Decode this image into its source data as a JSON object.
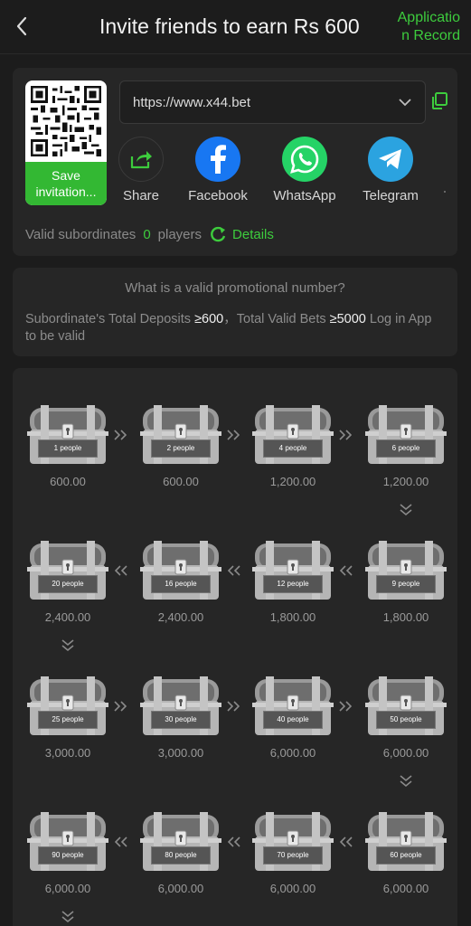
{
  "header": {
    "title": "Invite friends to earn Rs 600",
    "application_record": "Application Record"
  },
  "invite": {
    "save_label": "Save invitation...",
    "url": "https://www.x44.bet",
    "share": [
      {
        "label": "Share",
        "icon": "share-icon",
        "color": "#262626"
      },
      {
        "label": "Facebook",
        "icon": "facebook-icon",
        "color": "#1877f2"
      },
      {
        "label": "WhatsApp",
        "icon": "whatsapp-icon",
        "color": "#25d366"
      },
      {
        "label": "Telegram",
        "icon": "telegram-icon",
        "color": "#2ba3e0"
      }
    ],
    "valid_subordinates_label": "Valid subordinates",
    "valid_count": "0",
    "players_label": "players",
    "details_label": "Details"
  },
  "promo": {
    "question": "What is a valid promotional number?",
    "desc_prefix": "Subordinate's Total Deposits ",
    "deposit_value": "≥600",
    "desc_mid": "，Total Valid Bets ",
    "bet_value": "≥5000",
    "desc_suffix": " Log in App to be valid"
  },
  "rewards": [
    {
      "people": "1 people",
      "amount": "600.00"
    },
    {
      "people": "2 people",
      "amount": "600.00"
    },
    {
      "people": "4 people",
      "amount": "1,200.00"
    },
    {
      "people": "6 people",
      "amount": "1,200.00"
    },
    {
      "people": "9 people",
      "amount": "1,800.00"
    },
    {
      "people": "12 people",
      "amount": "1,800.00"
    },
    {
      "people": "16 people",
      "amount": "2,400.00"
    },
    {
      "people": "20 people",
      "amount": "2,400.00"
    },
    {
      "people": "25 people",
      "amount": "3,000.00"
    },
    {
      "people": "30 people",
      "amount": "3,000.00"
    },
    {
      "people": "40 people",
      "amount": "6,000.00"
    },
    {
      "people": "50 people",
      "amount": "6,000.00"
    },
    {
      "people": "60 people",
      "amount": "6,000.00"
    },
    {
      "people": "70 people",
      "amount": "6,000.00"
    },
    {
      "people": "80 people",
      "amount": "6,000.00"
    },
    {
      "people": "90 people",
      "amount": "6,000.00"
    }
  ],
  "colors": {
    "accent": "#3dcc3d",
    "background": "#1c1c1c",
    "card": "#262626"
  }
}
